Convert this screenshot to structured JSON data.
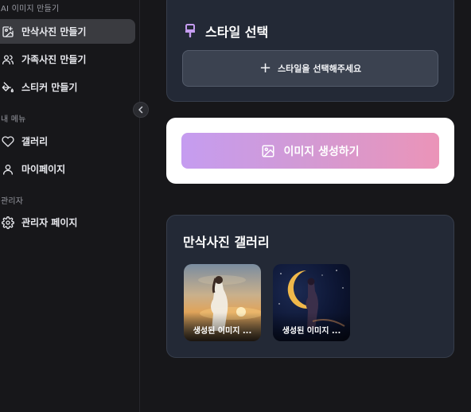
{
  "sidebar": {
    "section_ai": "AI 이미지 만들기",
    "items_ai": [
      {
        "label": "만삭사진 만들기",
        "icon": "image-plus-icon",
        "active": true
      },
      {
        "label": "가족사진 만들기",
        "icon": "users-icon",
        "active": false
      },
      {
        "label": "스티커 만들기",
        "icon": "paint-bucket-icon",
        "active": false
      }
    ],
    "section_my": "내 메뉴",
    "items_my": [
      {
        "label": "갤러리",
        "icon": "heart-icon"
      },
      {
        "label": "마이페이지",
        "icon": "user-icon"
      }
    ],
    "section_admin": "관리자",
    "items_admin": [
      {
        "label": "관리자 페이지",
        "icon": "gear-icon"
      }
    ]
  },
  "style_card": {
    "title": "스타일 선택",
    "icon": "brush-icon",
    "select_label": "스타일을 선택해주세요"
  },
  "generate": {
    "label": "이미지 생성하기",
    "icon": "image-icon"
  },
  "gallery": {
    "title": "만삭사진 갤러리",
    "items": [
      {
        "caption": "생성된 이미지 ..."
      },
      {
        "caption": "생성된 이미지 ..."
      }
    ]
  },
  "colors": {
    "accent_purple": "#c59cf0",
    "accent_pink": "#eb94b8",
    "card_bg": "#232936",
    "sidebar_active_bg": "#3a3b40"
  }
}
